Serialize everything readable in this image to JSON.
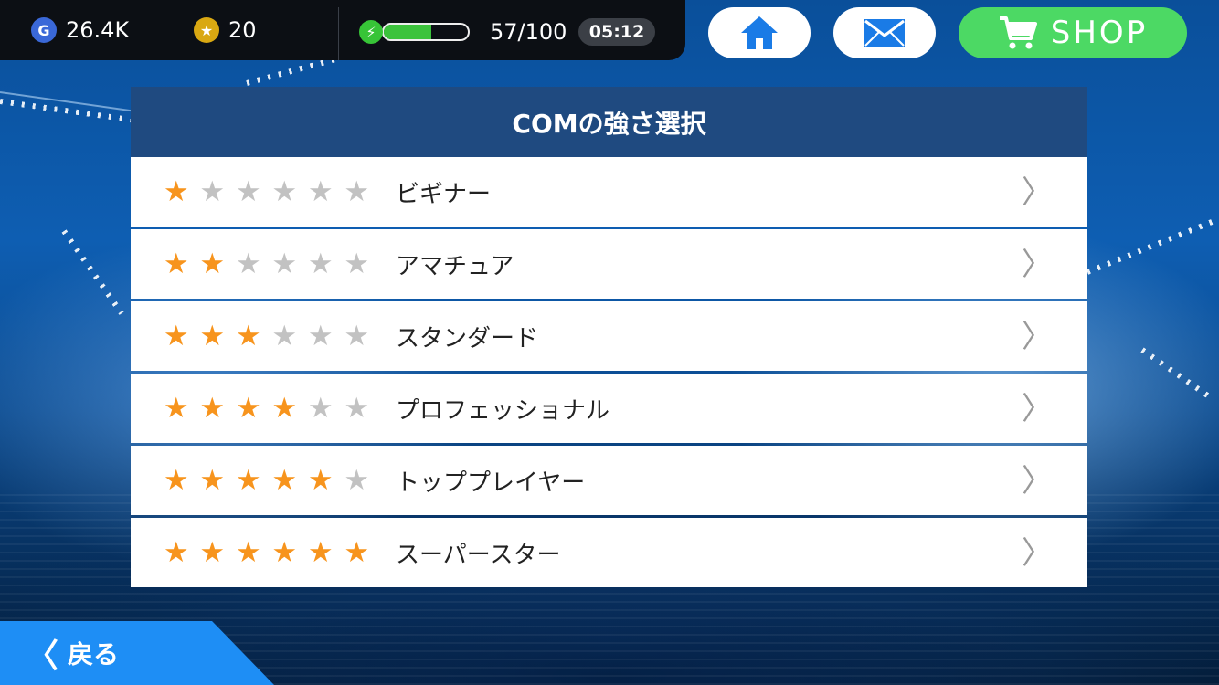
{
  "resources": {
    "gp": {
      "icon": "g-coin-icon",
      "value": "26.4K",
      "color": "#3a68d8"
    },
    "coins": {
      "icon": "star-coin-icon",
      "value": "20",
      "color": "#d9a812"
    },
    "stamina": {
      "icon": "lightning-icon",
      "value": "57/100",
      "fill_fraction": 0.57,
      "timer": "05:12",
      "color": "#3cc33c"
    }
  },
  "header_buttons": {
    "home_icon": "home-icon",
    "mail_icon": "mail-icon",
    "shop_label": "SHOP",
    "shop_icon": "cart-icon",
    "shop_color": "#4cd964",
    "icon_color": "#1a7be6"
  },
  "panel": {
    "title": "COMの強さ選択",
    "max_stars": 6,
    "star_on_color": "#f7941d",
    "star_off_color": "#c2c2c2",
    "levels": [
      {
        "stars": 1,
        "label": "ビギナー"
      },
      {
        "stars": 2,
        "label": "アマチュア"
      },
      {
        "stars": 3,
        "label": "スタンダード"
      },
      {
        "stars": 4,
        "label": "プロフェッショナル"
      },
      {
        "stars": 5,
        "label": "トッププレイヤー"
      },
      {
        "stars": 6,
        "label": "スーパースター"
      }
    ]
  },
  "back": {
    "label": "戻る",
    "icon": "chevron-left-icon"
  }
}
